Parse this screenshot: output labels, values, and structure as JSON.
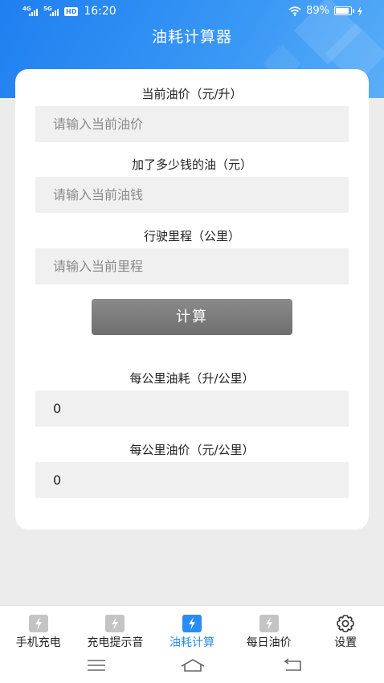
{
  "status_bar": {
    "net1": "4G",
    "net2": "5G",
    "hd": "HD",
    "time": "16:20",
    "battery": "89%"
  },
  "app": {
    "title": "油耗计算器"
  },
  "form": {
    "price_label": "当前油价（元/升）",
    "price_placeholder": "请输入当前油价",
    "money_label": "加了多少钱的油（元）",
    "money_placeholder": "请输入当前油钱",
    "distance_label": "行驶里程（公里）",
    "distance_placeholder": "请输入当前里程",
    "calc_button": "计算"
  },
  "results": {
    "consumption_label": "每公里油耗（升/公里）",
    "consumption_value": "0",
    "cost_label": "每公里油价（元/公里）",
    "cost_value": "0"
  },
  "nav": {
    "items": [
      {
        "label": "手机充电",
        "icon": "lightning-icon",
        "active": false
      },
      {
        "label": "充电提示音",
        "icon": "lightning-icon",
        "active": false
      },
      {
        "label": "油耗计算",
        "icon": "lightning-icon",
        "active": true
      },
      {
        "label": "每日油价",
        "icon": "lightning-icon",
        "active": false
      },
      {
        "label": "设置",
        "icon": "gear-icon",
        "active": false
      }
    ]
  },
  "colors": {
    "accent": "#2a8cf2",
    "button": "#7a7a7a",
    "field_bg": "#f0f0f0",
    "page_bg": "#ececec"
  }
}
